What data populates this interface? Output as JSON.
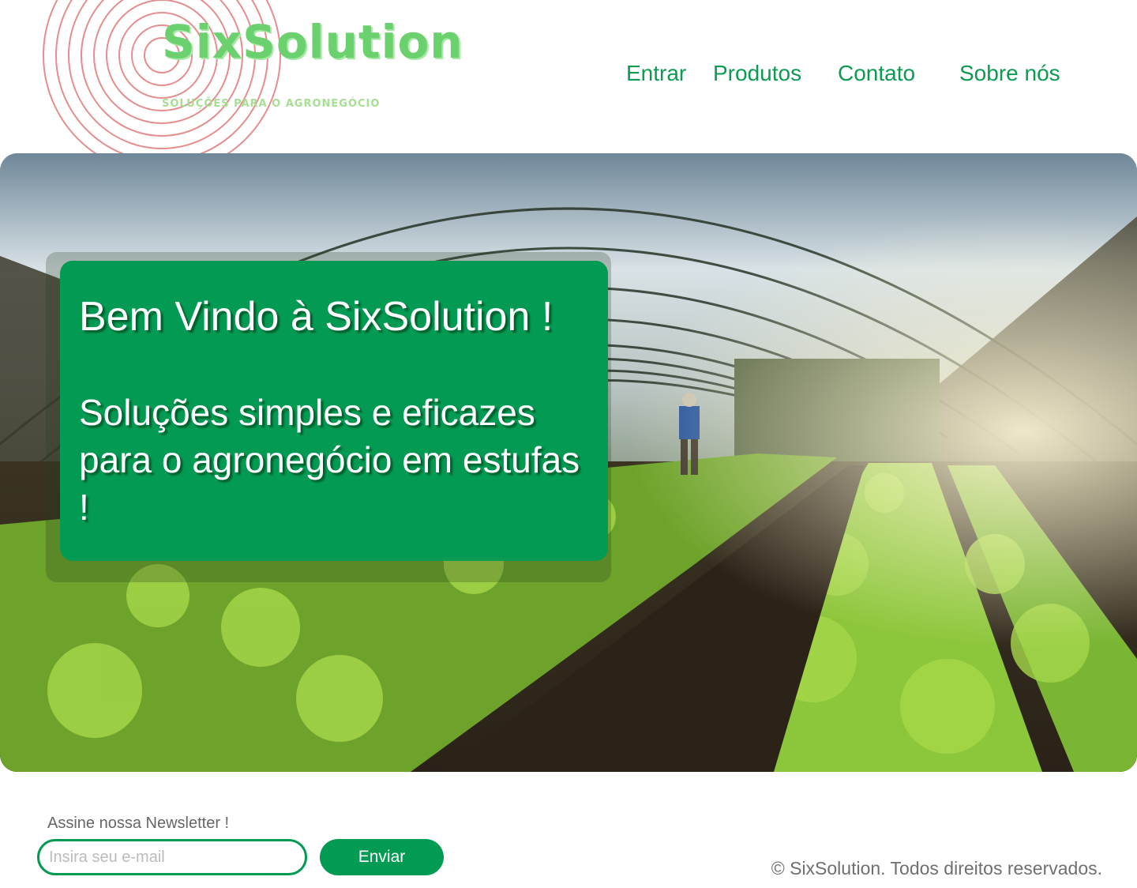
{
  "brand": {
    "name": "SixSolution",
    "tagline": "SOLUÇÕES PARA O AGRONEGÓCIO",
    "primary_color": "#039b53",
    "logo_color": "#6bd16e",
    "ring_color": "#e58e8e"
  },
  "nav": {
    "items": [
      {
        "label": "Entrar"
      },
      {
        "label": "Produtos"
      },
      {
        "label": "Contato"
      },
      {
        "label": "Sobre nós"
      }
    ]
  },
  "hero": {
    "image_subject": "greenhouse-lettuce-rows",
    "title": "Bem Vindo à SixSolution !",
    "subtitle": "Soluções simples e eficazes para o agronegócio em estufas !"
  },
  "footer": {
    "newsletter_label": "Assine nossa Newsletter !",
    "email_placeholder": "Insira seu e-mail",
    "email_value": "",
    "send_label": "Enviar",
    "copyright": "© SixSolution. Todos direitos reservados."
  }
}
